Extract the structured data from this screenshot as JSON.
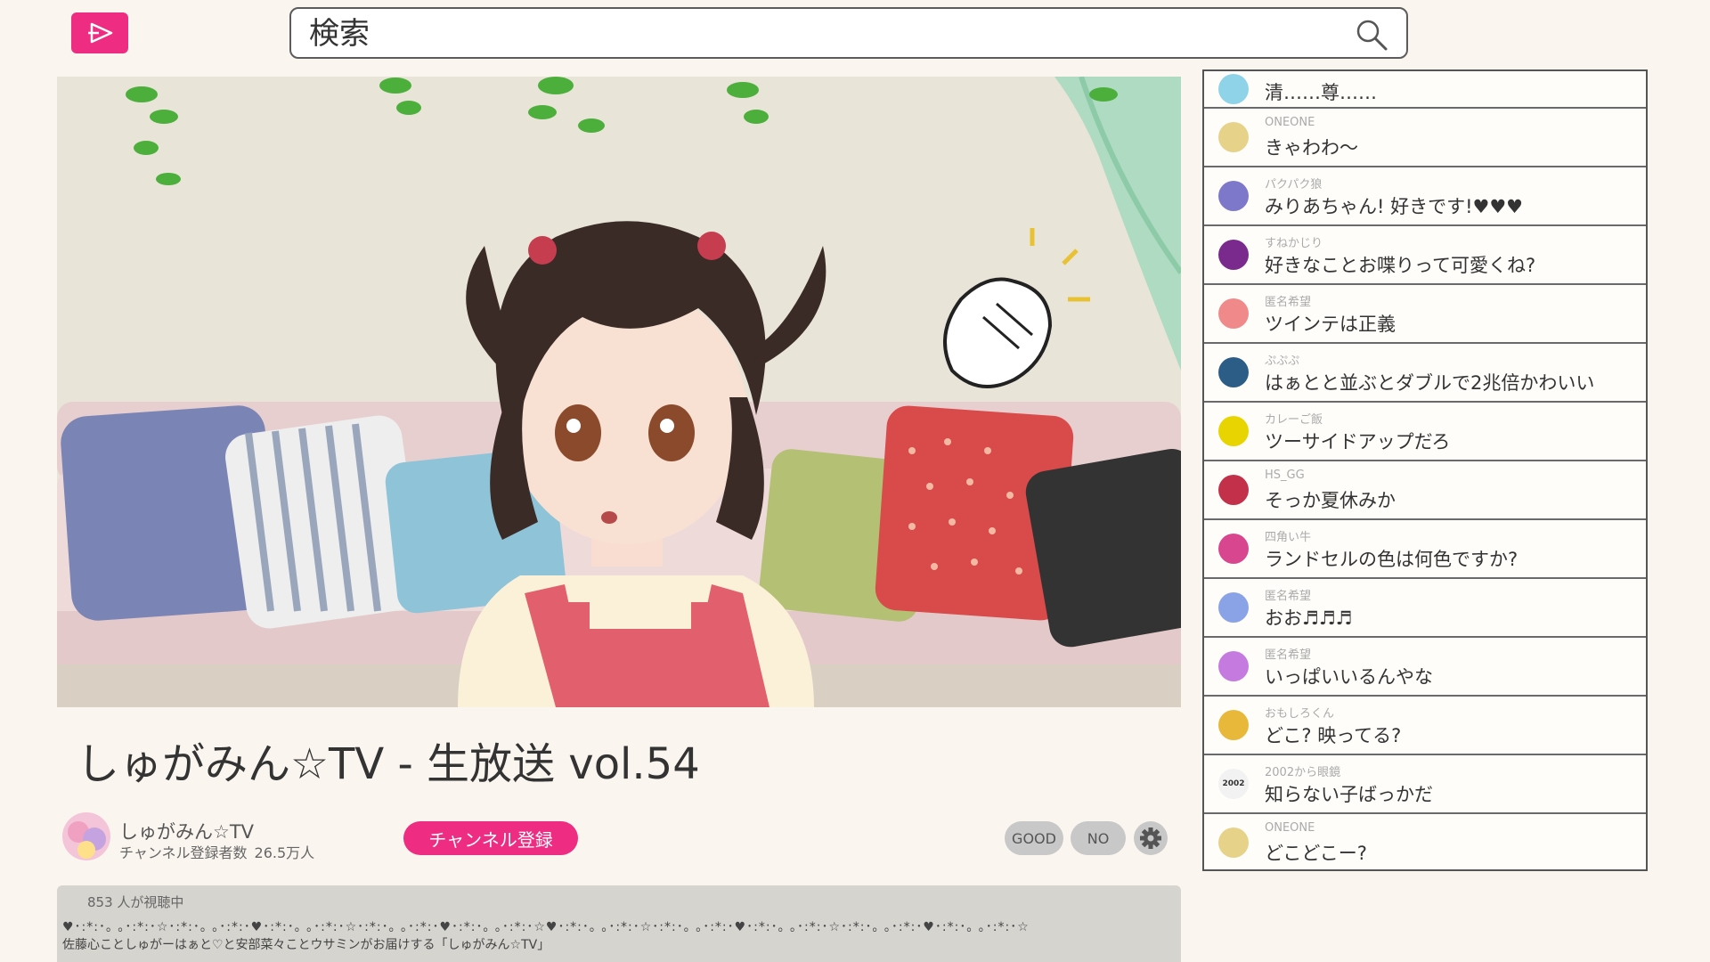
{
  "header": {
    "logo_icon": "play-logo-icon",
    "search_placeholder": "検索",
    "search_icon": "search-icon"
  },
  "video": {
    "title": "しゅがみん☆TV - 生放送 vol.54"
  },
  "channel": {
    "name": "しゅがみん☆TV",
    "subscribers_label": "チャンネル登録者数",
    "subscribers_count": "26.5万人",
    "subscribe_label": "チャンネル登録"
  },
  "actions": {
    "good_label": "GOOD",
    "no_label": "NO",
    "settings_icon": "gear-icon"
  },
  "description": {
    "viewers": "853 人が視聴中",
    "deco_line": "♥･:*:･｡ ｡･:*:･☆･:*:･｡ ｡･:*:･♥･:*:･｡ ｡･:*:･☆･:*:･｡ ｡･:*:･♥･:*:･｡ ｡･:*:･☆♥･:*:･｡ ｡･:*:･☆･:*:･｡ ｡･:*:･♥･:*:･｡ ｡･:*:･☆･:*:･｡ ｡･:*:･♥･:*:･｡ ｡･:*:･☆",
    "text": "佐藤心ことしゅがーはぁと♡と安部菜々ことウサミンがお届けする「しゅがみん☆TV」"
  },
  "chat": [
    {
      "user": "",
      "message": "清……尊……",
      "avatar_color": "#8fd3e8"
    },
    {
      "user": "ONEONE",
      "message": "きゃわわ〜",
      "avatar_color": "#e7d28a"
    },
    {
      "user": "パクパク狼",
      "message": "みりあちゃん! 好きです!♥♥♥",
      "avatar_color": "#7d78c9"
    },
    {
      "user": "すねかじり",
      "message": "好きなことお喋りって可愛くね?",
      "avatar_color": "#7a2a8c"
    },
    {
      "user": "匿名希望",
      "message": "ツインテは正義",
      "avatar_color": "#f08a8a"
    },
    {
      "user": "ぷぷぷ",
      "message": "はぁとと並ぶとダブルで2兆倍かわいい",
      "avatar_color": "#2b5d87"
    },
    {
      "user": "カレーご飯",
      "message": "ツーサイドアップだろ",
      "avatar_color": "#e8d400"
    },
    {
      "user": "HS_GG",
      "message": "そっか夏休みか",
      "avatar_color": "#c2304a"
    },
    {
      "user": "四角い牛",
      "message": "ランドセルの色は何色ですか?",
      "avatar_color": "#d7468e"
    },
    {
      "user": "匿名希望",
      "message": "おお♬♬♬",
      "avatar_color": "#8aa2e6"
    },
    {
      "user": "匿名希望",
      "message": "いっぱいいるんやな",
      "avatar_color": "#c57ae0"
    },
    {
      "user": "おもしろくん",
      "message": "どこ? 映ってる?",
      "avatar_color": "#e8b83a"
    },
    {
      "user": "2002から眼鏡",
      "message": "知らない子ばっかだ",
      "avatar_color": "#f2f2f2",
      "avatar_text": "2002"
    },
    {
      "user": "ONEONE",
      "message": "どこどこー?",
      "avatar_color": "#e7d28a"
    }
  ],
  "colors": {
    "accent": "#ee2c82",
    "background": "#faf6ef",
    "pill": "#c8c8c8"
  }
}
